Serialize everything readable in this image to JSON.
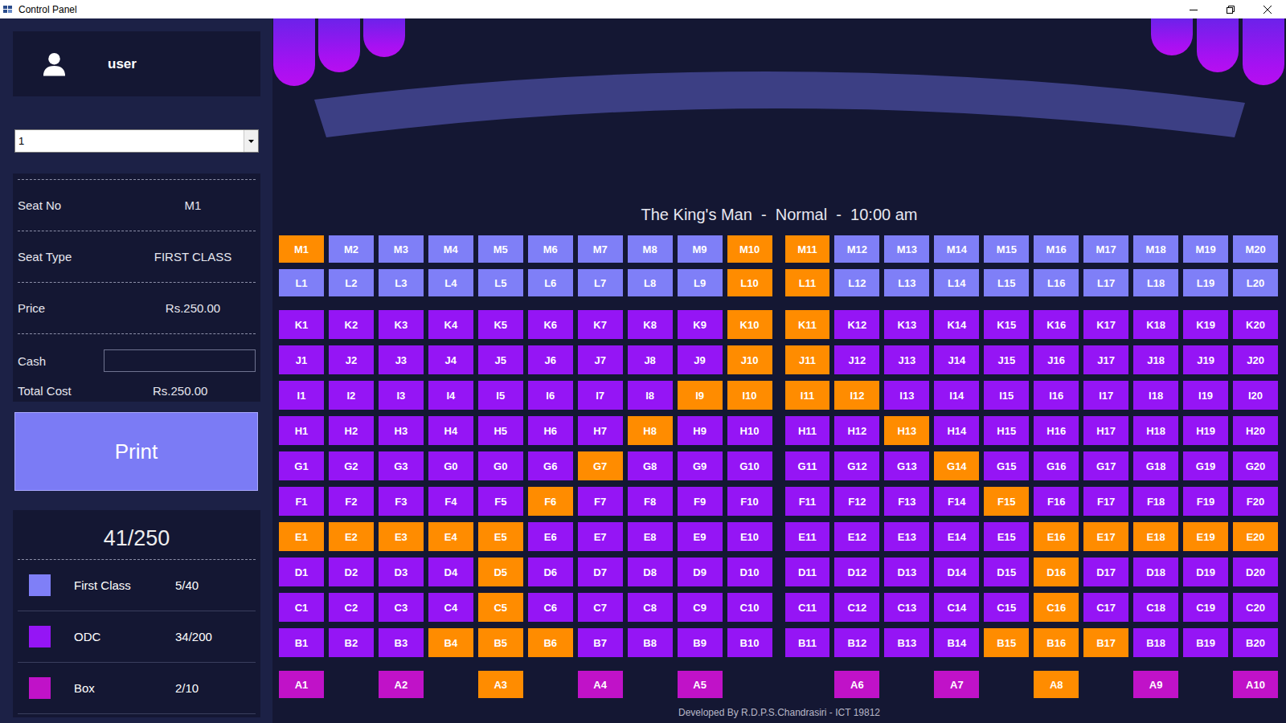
{
  "window": {
    "title": "Control Panel"
  },
  "user": {
    "name": "user"
  },
  "show_select": {
    "value": "1"
  },
  "ticket": {
    "fields": [
      {
        "label": "Seat No",
        "value": "M1"
      },
      {
        "label": "Seat Type",
        "value": "FIRST CLASS"
      },
      {
        "label": "Price",
        "value": "Rs.250.00"
      }
    ],
    "cash": {
      "label": "Cash",
      "value": ""
    },
    "total": {
      "label": "Total Cost",
      "value": "Rs.250.00"
    },
    "print_button": "Print"
  },
  "summary": {
    "count": "41/250",
    "categories": [
      {
        "name": "First Class",
        "count": "5/40",
        "kind": "first",
        "color": "#7f7ff7"
      },
      {
        "name": "ODC",
        "count": "34/200",
        "kind": "odc",
        "color": "#9515f5"
      },
      {
        "name": "Box",
        "count": "2/10",
        "kind": "box",
        "color": "#c012c8"
      }
    ]
  },
  "show": {
    "title": "The King's Man  -  Normal  -  10:00 am"
  },
  "seat_rows": [
    {
      "kind": "first",
      "seats": [
        {
          "label": "M1",
          "booked": true
        },
        {
          "label": "M2",
          "booked": false
        },
        {
          "label": "M3",
          "booked": false
        },
        {
          "label": "M4",
          "booked": false
        },
        {
          "label": "M5",
          "booked": false
        },
        {
          "label": "M6",
          "booked": false
        },
        {
          "label": "M7",
          "booked": false
        },
        {
          "label": "M8",
          "booked": false
        },
        {
          "label": "M9",
          "booked": false
        },
        {
          "label": "M10",
          "booked": true
        },
        {
          "label": "M11",
          "booked": true
        },
        {
          "label": "M12",
          "booked": false
        },
        {
          "label": "M13",
          "booked": false
        },
        {
          "label": "M14",
          "booked": false
        },
        {
          "label": "M15",
          "booked": false
        },
        {
          "label": "M16",
          "booked": false
        },
        {
          "label": "M17",
          "booked": false
        },
        {
          "label": "M18",
          "booked": false
        },
        {
          "label": "M19",
          "booked": false
        },
        {
          "label": "M20",
          "booked": false
        }
      ]
    },
    {
      "kind": "first",
      "seats": [
        {
          "label": "L1",
          "booked": false
        },
        {
          "label": "L2",
          "booked": false
        },
        {
          "label": "L3",
          "booked": false
        },
        {
          "label": "L4",
          "booked": false
        },
        {
          "label": "L5",
          "booked": false
        },
        {
          "label": "L6",
          "booked": false
        },
        {
          "label": "L7",
          "booked": false
        },
        {
          "label": "L8",
          "booked": false
        },
        {
          "label": "L9",
          "booked": false
        },
        {
          "label": "L10",
          "booked": true
        },
        {
          "label": "L11",
          "booked": true
        },
        {
          "label": "L12",
          "booked": false
        },
        {
          "label": "L13",
          "booked": false
        },
        {
          "label": "L14",
          "booked": false
        },
        {
          "label": "L15",
          "booked": false
        },
        {
          "label": "L16",
          "booked": false
        },
        {
          "label": "L17",
          "booked": false
        },
        {
          "label": "L18",
          "booked": false
        },
        {
          "label": "L19",
          "booked": false
        },
        {
          "label": "L20",
          "booked": false
        }
      ]
    },
    {
      "kind": "odc",
      "seats": [
        {
          "label": "K1",
          "booked": false
        },
        {
          "label": "K2",
          "booked": false
        },
        {
          "label": "K3",
          "booked": false
        },
        {
          "label": "K4",
          "booked": false
        },
        {
          "label": "K5",
          "booked": false
        },
        {
          "label": "K6",
          "booked": false
        },
        {
          "label": "K7",
          "booked": false
        },
        {
          "label": "K8",
          "booked": false
        },
        {
          "label": "K9",
          "booked": false
        },
        {
          "label": "K10",
          "booked": true
        },
        {
          "label": "K11",
          "booked": true
        },
        {
          "label": "K12",
          "booked": false
        },
        {
          "label": "K13",
          "booked": false
        },
        {
          "label": "K14",
          "booked": false
        },
        {
          "label": "K15",
          "booked": false
        },
        {
          "label": "K16",
          "booked": false
        },
        {
          "label": "K17",
          "booked": false
        },
        {
          "label": "K18",
          "booked": false
        },
        {
          "label": "K19",
          "booked": false
        },
        {
          "label": "K20",
          "booked": false
        }
      ]
    },
    {
      "kind": "odc",
      "seats": [
        {
          "label": "J1",
          "booked": false
        },
        {
          "label": "J2",
          "booked": false
        },
        {
          "label": "J3",
          "booked": false
        },
        {
          "label": "J4",
          "booked": false
        },
        {
          "label": "J5",
          "booked": false
        },
        {
          "label": "J6",
          "booked": false
        },
        {
          "label": "J7",
          "booked": false
        },
        {
          "label": "J8",
          "booked": false
        },
        {
          "label": "J9",
          "booked": false
        },
        {
          "label": "J10",
          "booked": true
        },
        {
          "label": "J11",
          "booked": true
        },
        {
          "label": "J12",
          "booked": false
        },
        {
          "label": "J13",
          "booked": false
        },
        {
          "label": "J14",
          "booked": false
        },
        {
          "label": "J15",
          "booked": false
        },
        {
          "label": "J16",
          "booked": false
        },
        {
          "label": "J17",
          "booked": false
        },
        {
          "label": "J18",
          "booked": false
        },
        {
          "label": "J19",
          "booked": false
        },
        {
          "label": "J20",
          "booked": false
        }
      ]
    },
    {
      "kind": "odc",
      "seats": [
        {
          "label": "I1",
          "booked": false
        },
        {
          "label": "I2",
          "booked": false
        },
        {
          "label": "I3",
          "booked": false
        },
        {
          "label": "I4",
          "booked": false
        },
        {
          "label": "I5",
          "booked": false
        },
        {
          "label": "I6",
          "booked": false
        },
        {
          "label": "I7",
          "booked": false
        },
        {
          "label": "I8",
          "booked": false
        },
        {
          "label": "I9",
          "booked": true
        },
        {
          "label": "I10",
          "booked": true
        },
        {
          "label": "I11",
          "booked": true
        },
        {
          "label": "I12",
          "booked": true
        },
        {
          "label": "I13",
          "booked": false
        },
        {
          "label": "I14",
          "booked": false
        },
        {
          "label": "I15",
          "booked": false
        },
        {
          "label": "I16",
          "booked": false
        },
        {
          "label": "I17",
          "booked": false
        },
        {
          "label": "I18",
          "booked": false
        },
        {
          "label": "I19",
          "booked": false
        },
        {
          "label": "I20",
          "booked": false
        }
      ]
    },
    {
      "kind": "odc",
      "seats": [
        {
          "label": "H1",
          "booked": false
        },
        {
          "label": "H2",
          "booked": false
        },
        {
          "label": "H3",
          "booked": false
        },
        {
          "label": "H4",
          "booked": false
        },
        {
          "label": "H5",
          "booked": false
        },
        {
          "label": "H6",
          "booked": false
        },
        {
          "label": "H7",
          "booked": false
        },
        {
          "label": "H8",
          "booked": true
        },
        {
          "label": "H9",
          "booked": false
        },
        {
          "label": "H10",
          "booked": false
        },
        {
          "label": "H11",
          "booked": false
        },
        {
          "label": "H12",
          "booked": false
        },
        {
          "label": "H13",
          "booked": true
        },
        {
          "label": "H14",
          "booked": false
        },
        {
          "label": "H15",
          "booked": false
        },
        {
          "label": "H16",
          "booked": false
        },
        {
          "label": "H17",
          "booked": false
        },
        {
          "label": "H18",
          "booked": false
        },
        {
          "label": "H19",
          "booked": false
        },
        {
          "label": "H20",
          "booked": false
        }
      ]
    },
    {
      "kind": "odc",
      "seats": [
        {
          "label": "G1",
          "booked": false
        },
        {
          "label": "G2",
          "booked": false
        },
        {
          "label": "G3",
          "booked": false
        },
        {
          "label": "G0",
          "booked": false
        },
        {
          "label": "G0",
          "booked": false
        },
        {
          "label": "G6",
          "booked": false
        },
        {
          "label": "G7",
          "booked": true
        },
        {
          "label": "G8",
          "booked": false
        },
        {
          "label": "G9",
          "booked": false
        },
        {
          "label": "G10",
          "booked": false
        },
        {
          "label": "G11",
          "booked": false
        },
        {
          "label": "G12",
          "booked": false
        },
        {
          "label": "G13",
          "booked": false
        },
        {
          "label": "G14",
          "booked": true
        },
        {
          "label": "G15",
          "booked": false
        },
        {
          "label": "G16",
          "booked": false
        },
        {
          "label": "G17",
          "booked": false
        },
        {
          "label": "G18",
          "booked": false
        },
        {
          "label": "G19",
          "booked": false
        },
        {
          "label": "G20",
          "booked": false
        }
      ]
    },
    {
      "kind": "odc",
      "seats": [
        {
          "label": "F1",
          "booked": false
        },
        {
          "label": "F2",
          "booked": false
        },
        {
          "label": "F3",
          "booked": false
        },
        {
          "label": "F4",
          "booked": false
        },
        {
          "label": "F5",
          "booked": false
        },
        {
          "label": "F6",
          "booked": true
        },
        {
          "label": "F7",
          "booked": false
        },
        {
          "label": "F8",
          "booked": false
        },
        {
          "label": "F9",
          "booked": false
        },
        {
          "label": "F10",
          "booked": false
        },
        {
          "label": "F11",
          "booked": false
        },
        {
          "label": "F12",
          "booked": false
        },
        {
          "label": "F13",
          "booked": false
        },
        {
          "label": "F14",
          "booked": false
        },
        {
          "label": "F15",
          "booked": true
        },
        {
          "label": "F16",
          "booked": false
        },
        {
          "label": "F17",
          "booked": false
        },
        {
          "label": "F18",
          "booked": false
        },
        {
          "label": "F19",
          "booked": false
        },
        {
          "label": "F20",
          "booked": false
        }
      ]
    },
    {
      "kind": "odc",
      "seats": [
        {
          "label": "E1",
          "booked": true
        },
        {
          "label": "E2",
          "booked": true
        },
        {
          "label": "E3",
          "booked": true
        },
        {
          "label": "E4",
          "booked": true
        },
        {
          "label": "E5",
          "booked": true
        },
        {
          "label": "E6",
          "booked": false
        },
        {
          "label": "E7",
          "booked": false
        },
        {
          "label": "E8",
          "booked": false
        },
        {
          "label": "E9",
          "booked": false
        },
        {
          "label": "E10",
          "booked": false
        },
        {
          "label": "E11",
          "booked": false
        },
        {
          "label": "E12",
          "booked": false
        },
        {
          "label": "E13",
          "booked": false
        },
        {
          "label": "E14",
          "booked": false
        },
        {
          "label": "E15",
          "booked": false
        },
        {
          "label": "E16",
          "booked": true
        },
        {
          "label": "E17",
          "booked": true
        },
        {
          "label": "E18",
          "booked": true
        },
        {
          "label": "E19",
          "booked": true
        },
        {
          "label": "E20",
          "booked": true
        }
      ]
    },
    {
      "kind": "odc",
      "seats": [
        {
          "label": "D1",
          "booked": false
        },
        {
          "label": "D2",
          "booked": false
        },
        {
          "label": "D3",
          "booked": false
        },
        {
          "label": "D4",
          "booked": false
        },
        {
          "label": "D5",
          "booked": true
        },
        {
          "label": "D6",
          "booked": false
        },
        {
          "label": "D7",
          "booked": false
        },
        {
          "label": "D8",
          "booked": false
        },
        {
          "label": "D9",
          "booked": false
        },
        {
          "label": "D10",
          "booked": false
        },
        {
          "label": "D11",
          "booked": false
        },
        {
          "label": "D12",
          "booked": false
        },
        {
          "label": "D13",
          "booked": false
        },
        {
          "label": "D14",
          "booked": false
        },
        {
          "label": "D15",
          "booked": false
        },
        {
          "label": "D16",
          "booked": true
        },
        {
          "label": "D17",
          "booked": false
        },
        {
          "label": "D18",
          "booked": false
        },
        {
          "label": "D19",
          "booked": false
        },
        {
          "label": "D20",
          "booked": false
        }
      ]
    },
    {
      "kind": "odc",
      "seats": [
        {
          "label": "C1",
          "booked": false
        },
        {
          "label": "C2",
          "booked": false
        },
        {
          "label": "C3",
          "booked": false
        },
        {
          "label": "C4",
          "booked": false
        },
        {
          "label": "C5",
          "booked": true
        },
        {
          "label": "C6",
          "booked": false
        },
        {
          "label": "C7",
          "booked": false
        },
        {
          "label": "C8",
          "booked": false
        },
        {
          "label": "C9",
          "booked": false
        },
        {
          "label": "C10",
          "booked": false
        },
        {
          "label": "C11",
          "booked": false
        },
        {
          "label": "C12",
          "booked": false
        },
        {
          "label": "C13",
          "booked": false
        },
        {
          "label": "C14",
          "booked": false
        },
        {
          "label": "C15",
          "booked": false
        },
        {
          "label": "C16",
          "booked": true
        },
        {
          "label": "C17",
          "booked": false
        },
        {
          "label": "C18",
          "booked": false
        },
        {
          "label": "C19",
          "booked": false
        },
        {
          "label": "C20",
          "booked": false
        }
      ]
    },
    {
      "kind": "odc",
      "seats": [
        {
          "label": "B1",
          "booked": false
        },
        {
          "label": "B2",
          "booked": false
        },
        {
          "label": "B3",
          "booked": false
        },
        {
          "label": "B4",
          "booked": true
        },
        {
          "label": "B5",
          "booked": true
        },
        {
          "label": "B6",
          "booked": true
        },
        {
          "label": "B7",
          "booked": false
        },
        {
          "label": "B8",
          "booked": false
        },
        {
          "label": "B9",
          "booked": false
        },
        {
          "label": "B10",
          "booked": false
        },
        {
          "label": "B11",
          "booked": false
        },
        {
          "label": "B12",
          "booked": false
        },
        {
          "label": "B13",
          "booked": false
        },
        {
          "label": "B14",
          "booked": false
        },
        {
          "label": "B15",
          "booked": true
        },
        {
          "label": "B16",
          "booked": true
        },
        {
          "label": "B17",
          "booked": true
        },
        {
          "label": "B18",
          "booked": false
        },
        {
          "label": "B19",
          "booked": false
        },
        {
          "label": "B20",
          "booked": false
        }
      ]
    },
    {
      "kind": "box",
      "seats": [
        {
          "label": "A1",
          "booked": false
        },
        {
          "label": "A2",
          "booked": false
        },
        {
          "label": "A3",
          "booked": true
        },
        {
          "label": "A4",
          "booked": false
        },
        {
          "label": "A5",
          "booked": false
        },
        {
          "label": "A6",
          "booked": false
        },
        {
          "label": "A7",
          "booked": false
        },
        {
          "label": "A8",
          "booked": true
        },
        {
          "label": "A9",
          "booked": false
        },
        {
          "label": "A10",
          "booked": false
        }
      ]
    }
  ],
  "footer": "Developed By R.D.P.S.Chandrasiri - ICT 19812"
}
